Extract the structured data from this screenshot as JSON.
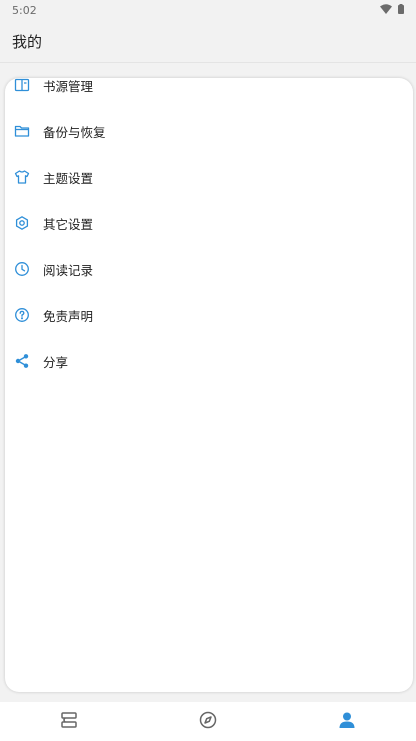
{
  "status_bar": {
    "time": "5:02",
    "icons": [
      "wifi-icon",
      "battery-icon"
    ]
  },
  "app_bar": {
    "title": "我的"
  },
  "menu": {
    "items": [
      {
        "label": "书源管理",
        "icon": "book-icon"
      },
      {
        "label": "备份与恢复",
        "icon": "folder-icon"
      },
      {
        "label": "主题设置",
        "icon": "tshirt-icon"
      },
      {
        "label": "其它设置",
        "icon": "gear-icon"
      },
      {
        "label": "阅读记录",
        "icon": "clock-icon"
      },
      {
        "label": "免责声明",
        "icon": "question-icon"
      },
      {
        "label": "分享",
        "icon": "share-icon"
      }
    ]
  },
  "bottom_nav": {
    "items": [
      {
        "icon": "bookshelf-icon",
        "active": false
      },
      {
        "icon": "compass-icon",
        "active": false
      },
      {
        "icon": "person-icon",
        "active": true
      }
    ]
  },
  "colors": {
    "accent": "#2f8fd8",
    "nav_inactive": "#666666",
    "background": "#f2f2f2"
  }
}
